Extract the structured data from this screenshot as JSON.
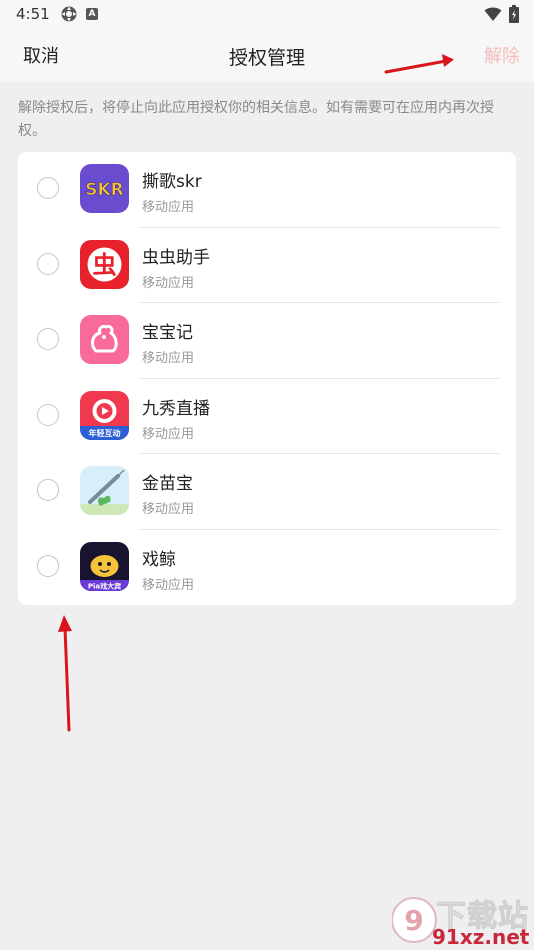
{
  "status_bar": {
    "time": "4:51",
    "icons": [
      "settings-icon",
      "a-badge-icon",
      "wifi-icon",
      "battery-icon"
    ],
    "a_badge": "A"
  },
  "header": {
    "cancel_label": "取消",
    "title": "授权管理",
    "revoke_label": "解除"
  },
  "description": "解除授权后，将停止向此应用授权你的相关信息。如有需要可在应用内再次授权。",
  "apps": [
    {
      "name": "撕歌skr",
      "type": "移动应用",
      "icon": "skr-app-icon",
      "icon_text": "SKR"
    },
    {
      "name": "虫虫助手",
      "type": "移动应用",
      "icon": "chongchong-app-icon",
      "icon_text": "虫"
    },
    {
      "name": "宝宝记",
      "type": "移动应用",
      "icon": "baobaoji-app-icon"
    },
    {
      "name": "九秀直播",
      "type": "移动应用",
      "icon": "jiuxiu-app-icon",
      "icon_text": "年轻互动"
    },
    {
      "name": "金苗宝",
      "type": "移动应用",
      "icon": "jinmiaobao-app-icon"
    },
    {
      "name": "戏鲸",
      "type": "移动应用",
      "icon": "xijing-app-icon",
      "icon_text": "Pia戏大宾"
    }
  ],
  "watermark": {
    "top": "下载站",
    "bottom": "91xz.net"
  },
  "colors": {
    "background": "#efeff1",
    "revoke_disabled": "#f6bcbc",
    "annotation_arrow": "#d9141c"
  }
}
